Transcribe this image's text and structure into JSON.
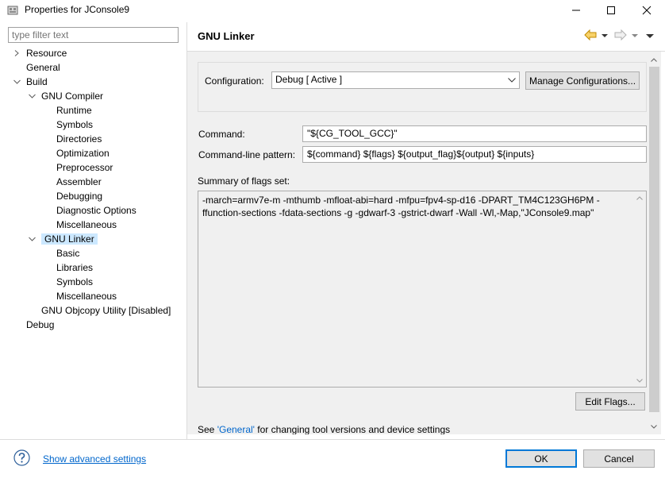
{
  "window": {
    "title": "Properties for JConsole9",
    "minimize_icon": "minimize-icon",
    "maximize_icon": "maximize-icon",
    "close_icon": "close-icon"
  },
  "filter": {
    "placeholder": "type filter text"
  },
  "tree": {
    "resource": "Resource",
    "general": "General",
    "build": "Build",
    "gnu_compiler": "GNU Compiler",
    "runtime": "Runtime",
    "symbols": "Symbols",
    "directories": "Directories",
    "optimization": "Optimization",
    "preprocessor": "Preprocessor",
    "assembler": "Assembler",
    "debugging": "Debugging",
    "diagnostic_options": "Diagnostic Options",
    "miscellaneous": "Miscellaneous",
    "gnu_linker": "GNU Linker",
    "basic": "Basic",
    "libraries": "Libraries",
    "linker_symbols": "Symbols",
    "linker_miscellaneous": "Miscellaneous",
    "gnu_objcopy": "GNU Objcopy Utility  [Disabled]",
    "debug": "Debug"
  },
  "page": {
    "title": "GNU Linker"
  },
  "configuration": {
    "label": "Configuration:",
    "value": "Debug  [ Active ]",
    "manage_label": "Manage Configurations..."
  },
  "command": {
    "label": "Command:",
    "value": "\"${CG_TOOL_GCC}\""
  },
  "pattern": {
    "label": "Command-line pattern:",
    "value": "${command} ${flags} ${output_flag}${output} ${inputs}"
  },
  "summary": {
    "label": "Summary of flags set:",
    "flags": "-march=armv7e-m -mthumb -mfloat-abi=hard -mfpu=fpv4-sp-d16 -DPART_TM4C123GH6PM -ffunction-sections -fdata-sections -g -gdwarf-3 -gstrict-dwarf -Wall -Wl,-Map,\"JConsole9.map\""
  },
  "edit_flags_label": "Edit Flags...",
  "note": {
    "prefix": "See ",
    "link": "'General'",
    "suffix": " for changing tool versions and device settings"
  },
  "footer": {
    "advanced_label": "Show advanced settings",
    "ok_label": "OK",
    "cancel_label": "Cancel"
  },
  "colors": {
    "link": "#0066cc",
    "selection": "#cce8ff",
    "default_button_border": "#0078d7",
    "back_arrow": "#e8a000"
  }
}
